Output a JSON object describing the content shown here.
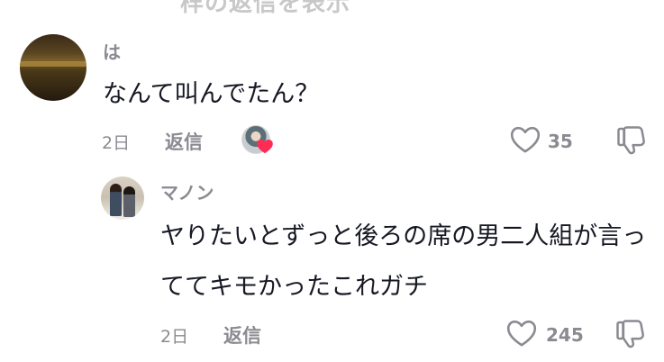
{
  "top_partial_text": "样の返信を表示",
  "comments": [
    {
      "username": "は",
      "text": "なんて叫んでたん？",
      "date": "2日",
      "reply_label": "返信",
      "like_count": "35",
      "creator_liked": true
    },
    {
      "username": "マノン",
      "text": "ヤりたいとずっと後ろの席の男二人組が言っててキモかったこれガチ",
      "date": "2日",
      "reply_label": "返信",
      "like_count": "245"
    }
  ],
  "icons": {
    "like": "heart-outline-icon",
    "dislike": "thumbs-down-icon",
    "creator_heart": "heart-filled-icon"
  },
  "colors": {
    "heart_red": "#fe2c55",
    "meta_gray": "#8a8b91",
    "text": "#161823"
  }
}
